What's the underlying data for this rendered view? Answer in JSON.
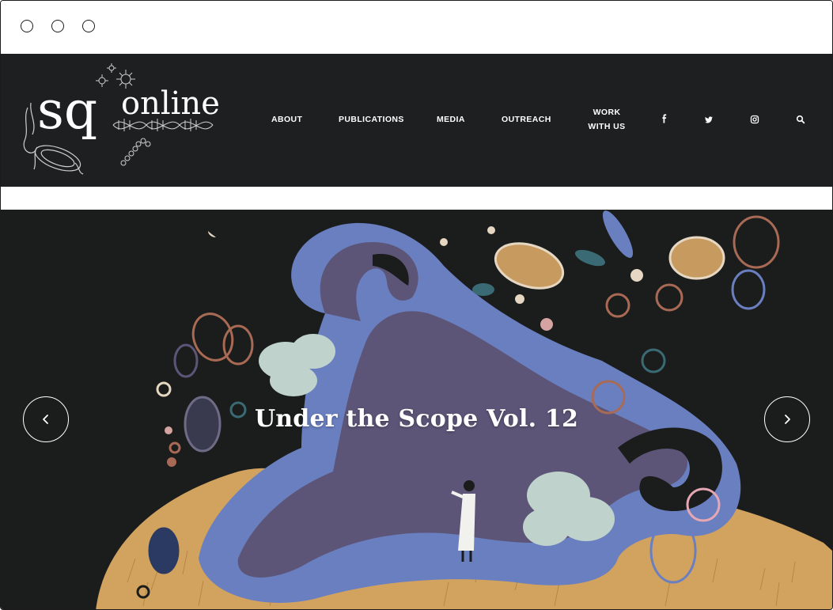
{
  "window": {
    "controls": [
      "close-control",
      "minimize-control",
      "maximize-control"
    ]
  },
  "site": {
    "logo": {
      "text_main": "sq",
      "text_sub": "online"
    },
    "nav": {
      "about": "ABOUT",
      "publications": "PUBLICATIONS",
      "media": "MEDIA",
      "outreach": "OUTREACH",
      "work_line1": "WORK",
      "work_line2": "WITH US"
    },
    "icons": [
      "facebook-icon",
      "twitter-icon",
      "instagram-icon",
      "search-icon"
    ]
  },
  "hero": {
    "title": "Under the Scope Vol. 12",
    "prev_icon": "chevron-left-icon",
    "next_icon": "chevron-right-icon"
  },
  "colors": {
    "header_bg": "#1e1f21",
    "hero_bg": "#1b1c1c",
    "uterus_blue": "#6a7fc0",
    "uterus_purple": "#5c5577",
    "grass": "#d2a25f",
    "cloud": "#bfd3cc"
  }
}
